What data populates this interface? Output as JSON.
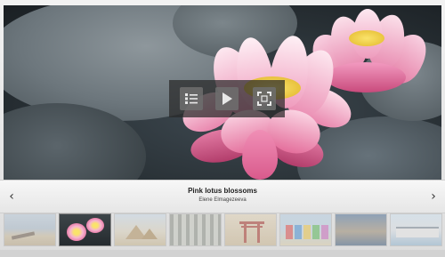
{
  "slide": {
    "title": "Pink lotus blossoms",
    "author": "Elene Elmagezeeva"
  },
  "controls": {
    "list_icon": "list-icon",
    "play_icon": "play-icon",
    "fullscreen_icon": "fullscreen-icon"
  },
  "navigation": {
    "prev_symbol": "‹",
    "next_symbol": "›"
  },
  "thumbnails": [
    {
      "subject": "beach-boats",
      "active": false
    },
    {
      "subject": "pink-lotus",
      "active": true
    },
    {
      "subject": "pyramids",
      "active": false
    },
    {
      "subject": "bamboo",
      "active": false
    },
    {
      "subject": "torii-gate",
      "active": false
    },
    {
      "subject": "beach-huts",
      "active": false
    },
    {
      "subject": "river-city",
      "active": false
    },
    {
      "subject": "modern-building",
      "active": false
    }
  ],
  "colors": {
    "lotus_pink": "#e9739f",
    "lotus_light": "#f7c3d6",
    "lotus_core": "#f2d64a",
    "overlay": "#282828"
  }
}
